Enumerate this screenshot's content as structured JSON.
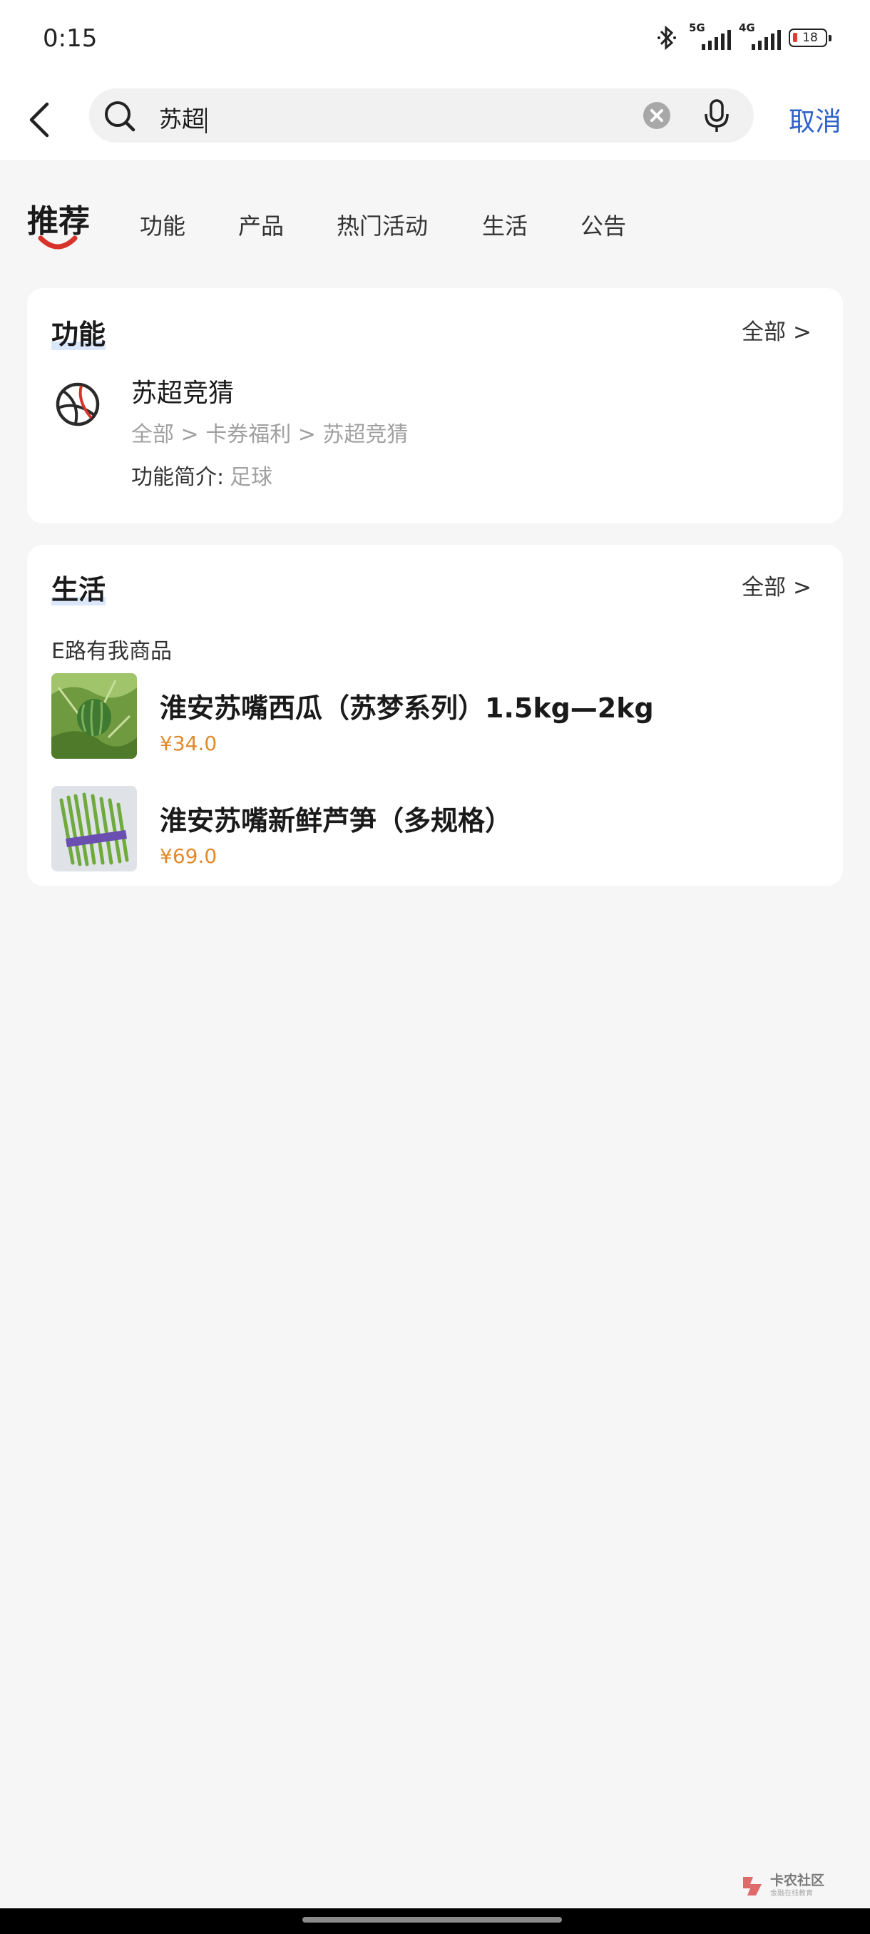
{
  "status": {
    "time": "0:15",
    "network_1": "5G",
    "network_2": "4G",
    "battery": "18"
  },
  "search": {
    "query": "苏超",
    "cancel_label": "取消"
  },
  "tabs": [
    {
      "label": "推荐",
      "active": true
    },
    {
      "label": "功能"
    },
    {
      "label": "产品"
    },
    {
      "label": "热门活动"
    },
    {
      "label": "生活"
    },
    {
      "label": "公告"
    }
  ],
  "function_section": {
    "title": "功能",
    "all_label": "全部 >",
    "item": {
      "name": "苏超竞猜",
      "path": "全部 > 卡券福利 > 苏超竞猜",
      "desc_label": "功能简介:",
      "desc_value": "足球"
    }
  },
  "life_section": {
    "title": "生活",
    "all_label": "全部 >",
    "shop_name": "E路有我商品",
    "products": [
      {
        "name": "淮安苏嘴西瓜（苏梦系列）1.5kg—2kg",
        "price": "¥34.0"
      },
      {
        "name": "淮安苏嘴新鲜芦笋（多规格）",
        "price": "¥69.0"
      }
    ]
  },
  "watermark": {
    "text": "卡农社区",
    "sub": "金融在线教育"
  },
  "colors": {
    "accent": "#2f62c9",
    "price": "#e28a2b",
    "tab_smile": "#d8332a"
  }
}
